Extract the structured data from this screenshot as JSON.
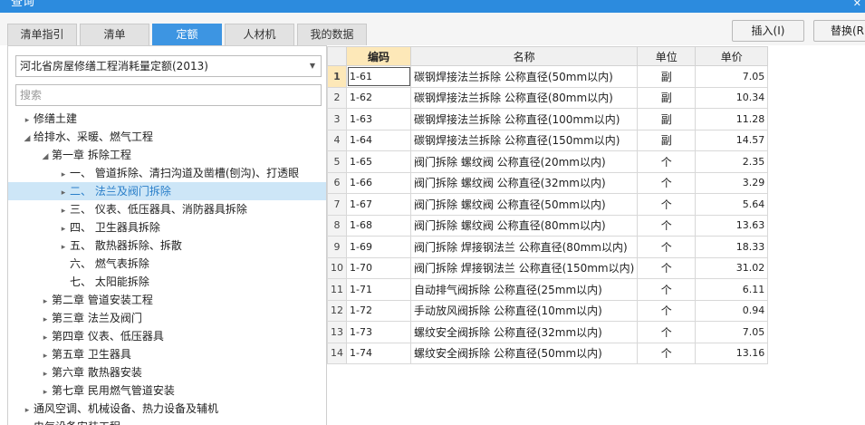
{
  "window": {
    "title": "查询",
    "close_glyph": "✕"
  },
  "tabs": [
    {
      "label": "清单指引",
      "active": false
    },
    {
      "label": "清单",
      "active": false
    },
    {
      "label": "定额",
      "active": true
    },
    {
      "label": "人材机",
      "active": false
    },
    {
      "label": "我的数据",
      "active": false
    }
  ],
  "toolbar": {
    "insert_label": "插入(I)",
    "replace_label": "替换(R"
  },
  "left": {
    "quota_select": "河北省房屋修缮工程消耗量定额(2013)",
    "search_placeholder": "搜索",
    "tree": [
      {
        "level": 0,
        "arrow": "▸",
        "label": "修缮土建"
      },
      {
        "level": 0,
        "arrow": "◢",
        "label": "给排水、采暖、燃气工程"
      },
      {
        "level": 1,
        "arrow": "◢",
        "label": "第一章 拆除工程"
      },
      {
        "level": 2,
        "arrow": "▸",
        "label": "一、 管道拆除、清扫沟道及凿槽(刨沟)、打透眼"
      },
      {
        "level": 2,
        "arrow": "▸",
        "label": "二、 法兰及阀门拆除",
        "selected": true
      },
      {
        "level": 2,
        "arrow": "▸",
        "label": "三、 仪表、低压器具、消防器具拆除"
      },
      {
        "level": 2,
        "arrow": "▸",
        "label": "四、 卫生器具拆除"
      },
      {
        "level": 2,
        "arrow": "▸",
        "label": "五、 散热器拆除、拆散"
      },
      {
        "level": 2,
        "arrow": "",
        "label": "六、 燃气表拆除"
      },
      {
        "level": 2,
        "arrow": "",
        "label": "七、 太阳能拆除"
      },
      {
        "level": 1,
        "arrow": "▸",
        "label": "第二章 管道安装工程"
      },
      {
        "level": 1,
        "arrow": "▸",
        "label": "第三章 法兰及阀门"
      },
      {
        "level": 1,
        "arrow": "▸",
        "label": "第四章 仪表、低压器具"
      },
      {
        "level": 1,
        "arrow": "▸",
        "label": "第五章 卫生器具"
      },
      {
        "level": 1,
        "arrow": "▸",
        "label": "第六章 散热器安装"
      },
      {
        "level": 1,
        "arrow": "▸",
        "label": "第七章 民用燃气管道安装"
      },
      {
        "level": 0,
        "arrow": "▸",
        "label": "通风空调、机械设备、热力设备及辅机"
      },
      {
        "level": 0,
        "arrow": "▸",
        "label": "电气设备安装工程"
      }
    ]
  },
  "grid": {
    "headers": {
      "code": "编码",
      "name": "名称",
      "unit": "单位",
      "price": "单价"
    },
    "rows": [
      {
        "n": "1",
        "code": "1-61",
        "name": "碳钢焊接法兰拆除 公称直径(50mm以内)",
        "unit": "副",
        "price": "7.05"
      },
      {
        "n": "2",
        "code": "1-62",
        "name": "碳钢焊接法兰拆除 公称直径(80mm以内)",
        "unit": "副",
        "price": "10.34"
      },
      {
        "n": "3",
        "code": "1-63",
        "name": "碳钢焊接法兰拆除 公称直径(100mm以内)",
        "unit": "副",
        "price": "11.28"
      },
      {
        "n": "4",
        "code": "1-64",
        "name": "碳钢焊接法兰拆除 公称直径(150mm以内)",
        "unit": "副",
        "price": "14.57"
      },
      {
        "n": "5",
        "code": "1-65",
        "name": "阀门拆除 螺纹阀 公称直径(20mm以内)",
        "unit": "个",
        "price": "2.35"
      },
      {
        "n": "6",
        "code": "1-66",
        "name": "阀门拆除 螺纹阀 公称直径(32mm以内)",
        "unit": "个",
        "price": "3.29"
      },
      {
        "n": "7",
        "code": "1-67",
        "name": "阀门拆除 螺纹阀 公称直径(50mm以内)",
        "unit": "个",
        "price": "5.64"
      },
      {
        "n": "8",
        "code": "1-68",
        "name": "阀门拆除 螺纹阀 公称直径(80mm以内)",
        "unit": "个",
        "price": "13.63"
      },
      {
        "n": "9",
        "code": "1-69",
        "name": "阀门拆除 焊接钢法兰 公称直径(80mm以内)",
        "unit": "个",
        "price": "18.33"
      },
      {
        "n": "10",
        "code": "1-70",
        "name": "阀门拆除 焊接钢法兰 公称直径(150mm以内)",
        "unit": "个",
        "price": "31.02"
      },
      {
        "n": "11",
        "code": "1-71",
        "name": "自动排气阀拆除 公称直径(25mm以内)",
        "unit": "个",
        "price": "6.11"
      },
      {
        "n": "12",
        "code": "1-72",
        "name": "手动放风阀拆除 公称直径(10mm以内)",
        "unit": "个",
        "price": "0.94"
      },
      {
        "n": "13",
        "code": "1-73",
        "name": "螺纹安全阀拆除 公称直径(32mm以内)",
        "unit": "个",
        "price": "7.05"
      },
      {
        "n": "14",
        "code": "1-74",
        "name": "螺纹安全阀拆除 公称直径(50mm以内)",
        "unit": "个",
        "price": "13.16"
      }
    ]
  }
}
